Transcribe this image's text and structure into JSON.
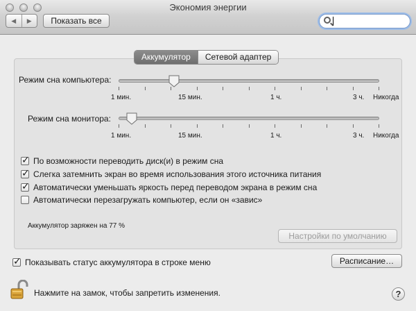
{
  "window": {
    "title": "Экономия энергии"
  },
  "toolbar": {
    "back_glyph": "◀",
    "forward_glyph": "▶",
    "show_all_label": "Показать все",
    "search_value": ""
  },
  "tabs": [
    {
      "label": "Аккумулятор",
      "selected": true
    },
    {
      "label": "Сетевой адаптер",
      "selected": false
    }
  ],
  "sliders": {
    "computer": {
      "label": "Режим сна компьютера:",
      "value_label": "15 мин.",
      "ticks": [
        "1 мин.",
        "15 мин.",
        "1 ч.",
        "3 ч.",
        "Никогда"
      ]
    },
    "display": {
      "label": "Режим сна монитора:",
      "value_label": "1 мин.",
      "ticks": [
        "1 мин.",
        "15 мин.",
        "1 ч.",
        "3 ч.",
        "Никогда"
      ]
    }
  },
  "options": [
    {
      "label": "По возможности переводить диск(и) в режим сна",
      "checked": true
    },
    {
      "label": "Слегка затемнить экран во время использования этого источника питания",
      "checked": true
    },
    {
      "label": "Автоматически уменьшать яркость перед переводом экрана в режим сна",
      "checked": true
    },
    {
      "label": "Автоматически перезагружать компьютер, если он «завис»",
      "checked": false
    }
  ],
  "battery_status": "Аккумулятор заряжен на 77 %",
  "defaults_button": "Настройки по умолчанию",
  "show_menu_status": {
    "label": "Показывать статус аккумулятора в строке меню",
    "checked": true
  },
  "schedule_button": "Расписание…",
  "lock_text": "Нажмите на замок, чтобы запретить изменения.",
  "help_label": "?",
  "check_glyph": "✓"
}
